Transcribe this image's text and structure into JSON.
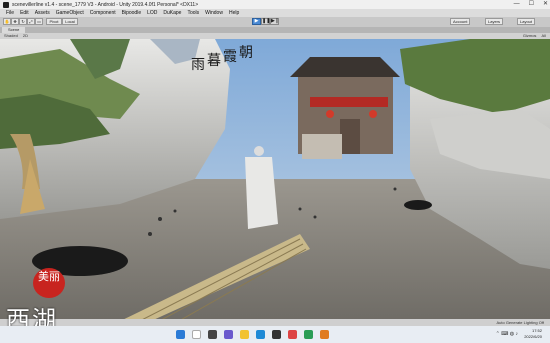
{
  "titlebar": {
    "title": "scenevillerline v1.4 - scene_1779 V3 - Android - Unity 2019.4.0f1 Personal* <DX11>",
    "min": "—",
    "max": "☐",
    "close": "✕"
  },
  "menubar": {
    "items": [
      "File",
      "Edit",
      "Assets",
      "GameObject",
      "Component",
      "Bipoodle",
      "LOD",
      "DuKape",
      "Tools",
      "Window",
      "Help"
    ]
  },
  "toolbar": {
    "pivot_label": "Pivot",
    "local_label": "Local",
    "account_label": "Account",
    "layers_label": "Layers",
    "layout_label": "Layout"
  },
  "scene_tab": {
    "label": "Scene"
  },
  "scene_options": {
    "shading": "Shaded",
    "mode": "2D",
    "gizmos": "Gizmos",
    "search": "All"
  },
  "calligraphy": {
    "col1": "朝",
    "col2": "霞",
    "col3": "暮",
    "col4": "雨"
  },
  "logo": {
    "seal_text": "美丽",
    "name": "西湖"
  },
  "statusbar": {
    "right_text": "Auto Generate Lighting Off"
  },
  "taskbar": {
    "time": "17:52",
    "date": "2022/6/20"
  }
}
